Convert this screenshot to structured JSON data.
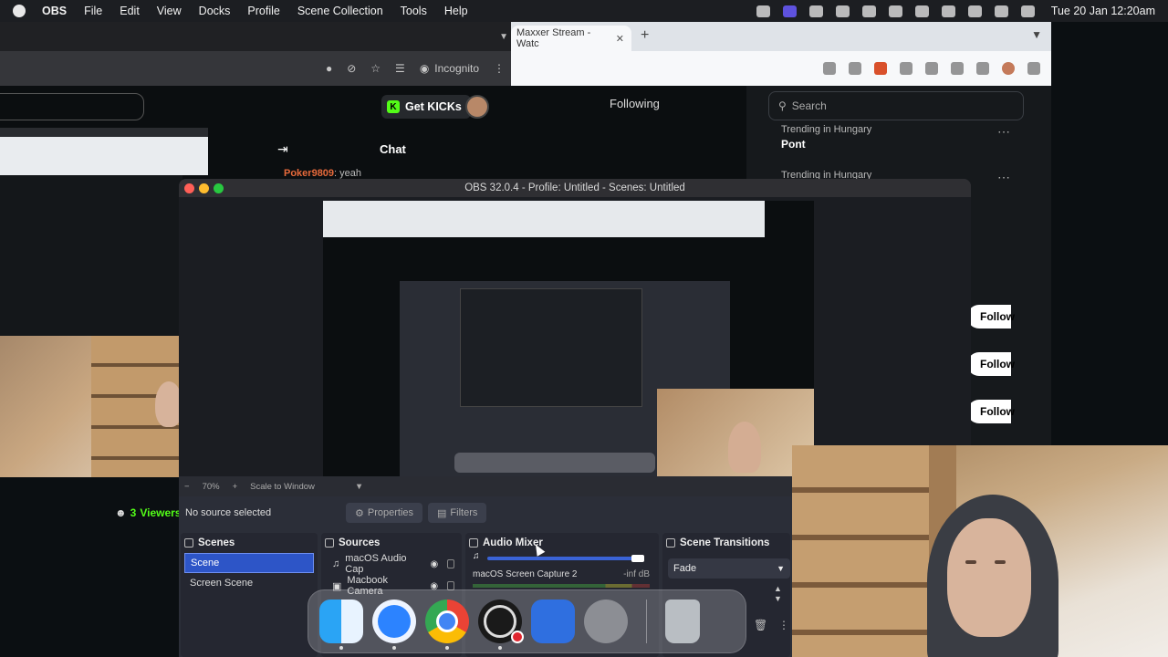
{
  "menubar": {
    "app": "OBS",
    "items": [
      "File",
      "Edit",
      "View",
      "Docks",
      "Profile",
      "Scene Collection",
      "Tools",
      "Help"
    ],
    "clock": "Tue 20 Jan  12:20am"
  },
  "browser_left": {
    "incognito": "Incognito",
    "get_kicks": "Get KICKs",
    "chat_title": "Chat",
    "chat_user": "Poker9809",
    "chat_text": ": yeah",
    "viewers_count": "3",
    "viewers_label": "Viewers"
  },
  "browser_right": {
    "tab_title": "Maxxer Stream - Watc",
    "following": "Following",
    "search_placeholder": "Search",
    "trending": [
      {
        "label": "Trending in Hungary",
        "name": "Pont"
      },
      {
        "label": "Trending in Hungary",
        "name": ""
      }
    ],
    "follow_label": "Follow"
  },
  "obs": {
    "window_title": "OBS 32.0.4 - Profile: Untitled - Scenes: Untitled",
    "zoom": "70%",
    "scale_label": "Scale to Window",
    "no_source": "No source selected",
    "properties_label": "Properties",
    "filters_label": "Filters",
    "scenes_title": "Scenes",
    "scenes": [
      "Scene",
      "Screen Scene"
    ],
    "sources_title": "Sources",
    "sources": [
      "macOS Audio Cap",
      "Macbook Camera"
    ],
    "mixer_title": "Audio Mixer",
    "mixer_track": "macOS Screen Capture 2",
    "mixer_db": "-inf dB",
    "transitions_title": "Scene Transitions",
    "transition_value": "Fade"
  },
  "dock": {
    "apps": [
      "finder-icon",
      "safari-icon",
      "chrome-icon",
      "obs-icon",
      "vm-icon",
      "settings-icon",
      "trash-icon"
    ]
  }
}
